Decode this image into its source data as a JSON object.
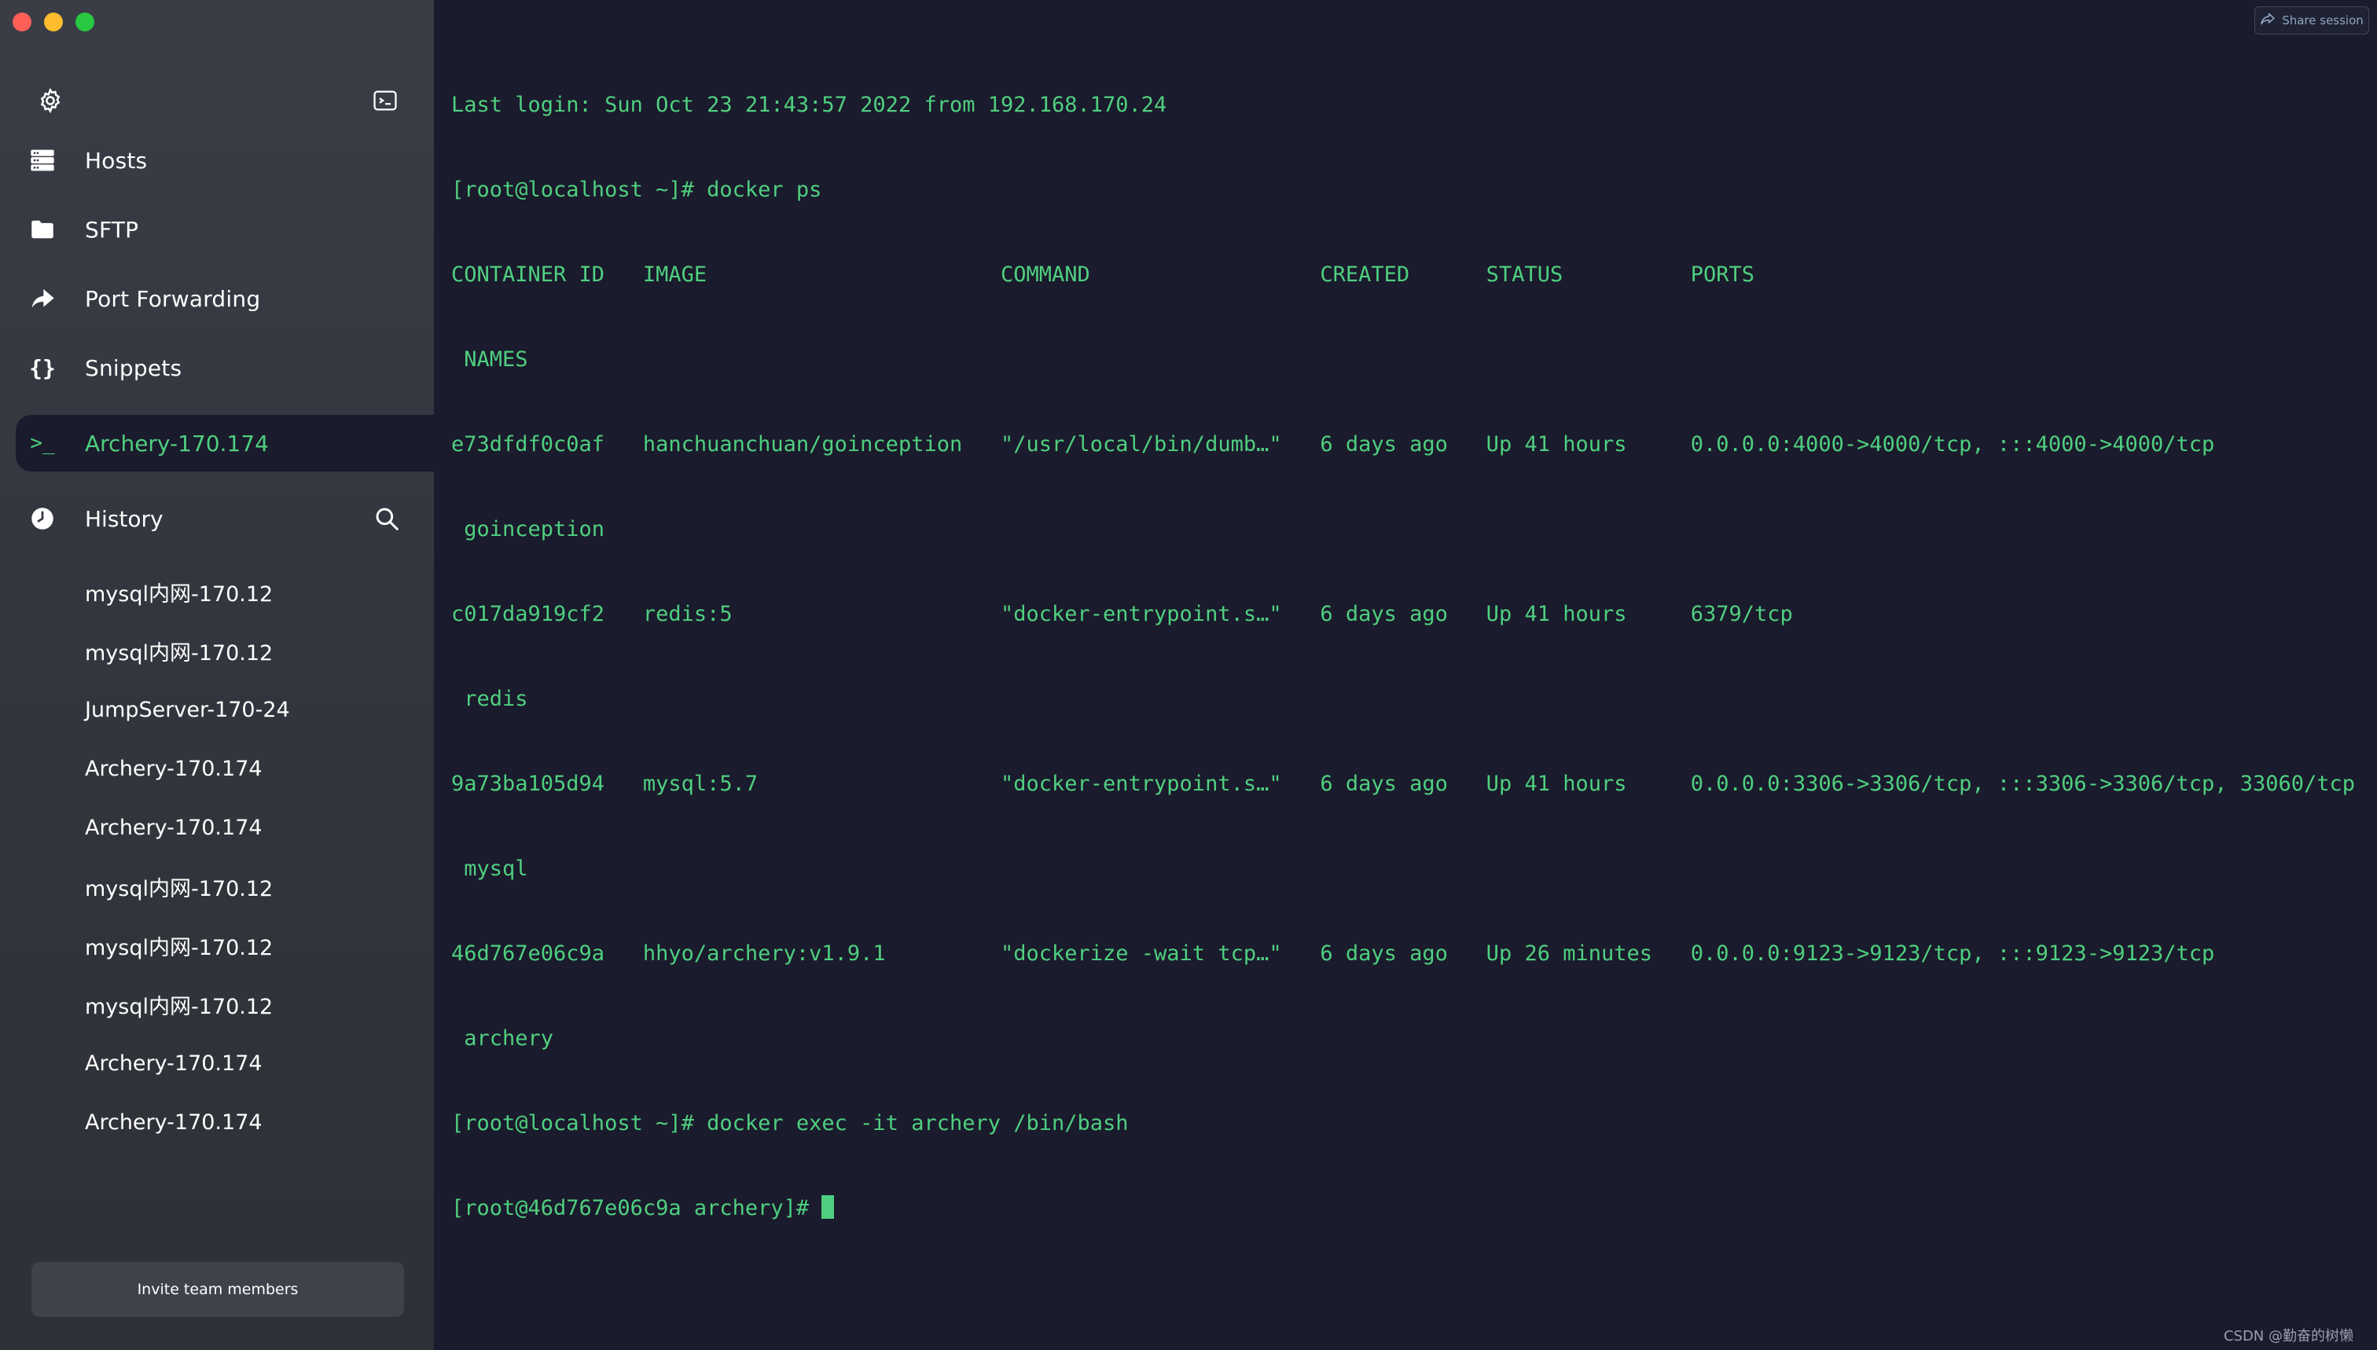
{
  "sidebar": {
    "nav": [
      {
        "label": "Hosts",
        "icon": "hosts-icon"
      },
      {
        "label": "SFTP",
        "icon": "folder-icon"
      },
      {
        "label": "Port Forwarding",
        "icon": "forward-arrow-icon"
      },
      {
        "label": "Snippets",
        "icon": "braces-icon"
      }
    ],
    "active_session": {
      "label": "Archery-170.174",
      "icon": "terminal-prompt-icon"
    },
    "history": {
      "label": "History",
      "items": [
        "mysql内网-170.12",
        "mysql内网-170.12",
        "JumpServer-170-24",
        "Archery-170.174",
        "Archery-170.174",
        "mysql内网-170.12",
        "mysql内网-170.12",
        "mysql内网-170.12",
        "Archery-170.174",
        "Archery-170.174"
      ]
    },
    "invite_label": "Invite team members"
  },
  "terminal": {
    "share_label": "Share session",
    "lines": [
      "Last login: Sun Oct 23 21:43:57 2022 from 192.168.170.24",
      "[root@localhost ~]# docker ps",
      "CONTAINER ID   IMAGE                       COMMAND                  CREATED      STATUS          PORTS",
      " NAMES",
      "e73dfdf0c0af   hanchuanchuan/goinception   \"/usr/local/bin/dumb…\"   6 days ago   Up 41 hours     0.0.0.0:4000->4000/tcp, :::4000->4000/tcp",
      " goinception",
      "c017da919cf2   redis:5                     \"docker-entrypoint.s…\"   6 days ago   Up 41 hours     6379/tcp",
      " redis",
      "9a73ba105d94   mysql:5.7                   \"docker-entrypoint.s…\"   6 days ago   Up 41 hours     0.0.0.0:3306->3306/tcp, :::3306->3306/tcp, 33060/tcp",
      " mysql",
      "46d767e06c9a   hhyo/archery:v1.9.1         \"dockerize -wait tcp…\"   6 days ago   Up 26 minutes   0.0.0.0:9123->9123/tcp, :::9123->9123/tcp",
      " archery",
      "[root@localhost ~]# docker exec -it archery /bin/bash"
    ],
    "prompt": "[root@46d767e06c9a archery]# ",
    "text_color": "#4fcf7f",
    "background": "#1a1b2c"
  },
  "watermark": "CSDN @勤奋的树懒"
}
